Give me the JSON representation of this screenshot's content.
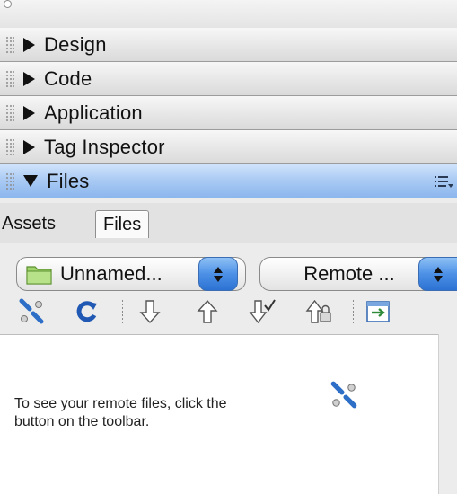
{
  "panels": [
    {
      "label": "Design",
      "expanded": false
    },
    {
      "label": "Code",
      "expanded": false
    },
    {
      "label": "Application",
      "expanded": false
    },
    {
      "label": "Tag Inspector",
      "expanded": false
    },
    {
      "label": "Files",
      "expanded": true
    }
  ],
  "tabs": [
    {
      "label": "Assets",
      "selected": false
    },
    {
      "label": "Files",
      "selected": true
    }
  ],
  "site_select": {
    "value": "Unnamed..."
  },
  "view_select": {
    "value": "Remote ..."
  },
  "toolbar": {
    "icons": [
      "connect-icon",
      "refresh-icon",
      "get-files-icon",
      "put-files-icon",
      "check-out-icon",
      "check-in-icon",
      "expand-icon"
    ]
  },
  "message": {
    "line1": "To see your remote files, click the",
    "line2": "button on the toolbar."
  },
  "colors": {
    "active_header": "#a8c9f3",
    "stepper_blue": "#4c90e6"
  }
}
